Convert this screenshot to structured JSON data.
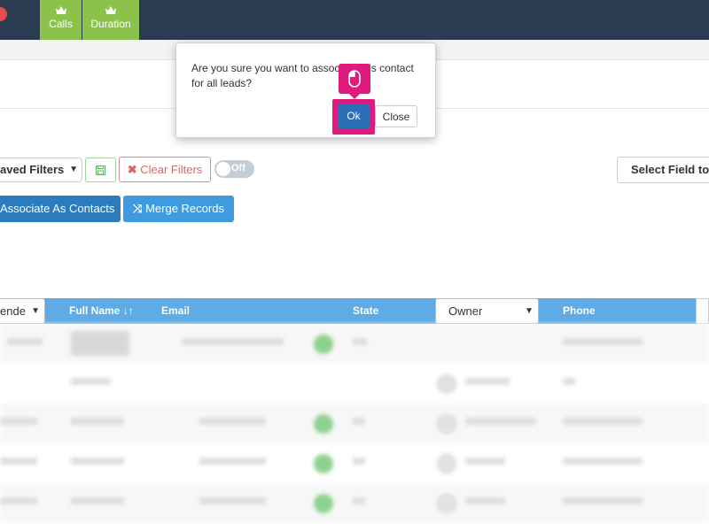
{
  "topbar": {
    "tabs": [
      {
        "label": "Calls",
        "icon": "crown-icon"
      },
      {
        "label": "Duration",
        "icon": "crown-icon"
      }
    ]
  },
  "filters": {
    "saved_filters_label": "aved Filters",
    "save_icon": "save-icon",
    "clear_filters_label": "Clear Filters",
    "toggle_label": "Off",
    "select_field_label": "Select Field to"
  },
  "actions": {
    "associate_label": "Associate As Contacts",
    "merge_label": "Merge Records"
  },
  "table": {
    "first_select_value": "ende",
    "columns": {
      "full_name": "Full Name",
      "sort_icon": "↓↑",
      "email": "Email",
      "state": "State",
      "owner_select": "Owner",
      "phone": "Phone"
    }
  },
  "dialog": {
    "message": "Are you sure you want to associate this contact for all leads?",
    "ok_label": "Ok",
    "close_label": "Close"
  },
  "colors": {
    "topbar": "#2b3b52",
    "accent_green": "#8bc34a",
    "primary_blue": "#2a7cbf",
    "table_header": "#5eabe6",
    "highlight_pink": "#e0197d"
  }
}
